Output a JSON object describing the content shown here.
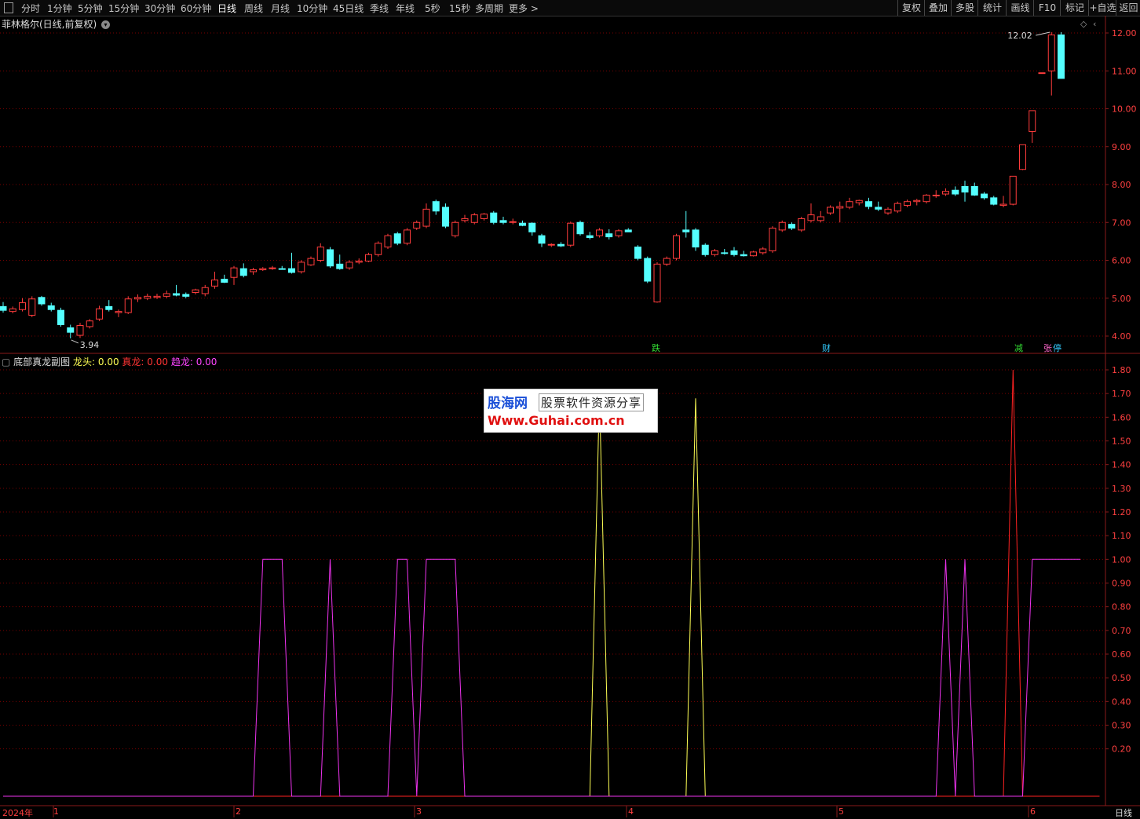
{
  "toolbar": {
    "periods": [
      "分时",
      "1分钟",
      "5分钟",
      "15分钟",
      "30分钟",
      "60分钟",
      "日线",
      "周线",
      "月线",
      "10分钟",
      "45日线",
      "季线",
      "年线",
      "5秒",
      "15秒",
      "多周期",
      "更多 >"
    ],
    "active_period": "日线",
    "right_buttons": [
      "复权",
      "叠加",
      "多股",
      "统计",
      "画线",
      "F10",
      "标记",
      "+自选",
      "返回"
    ]
  },
  "stock": {
    "title": "菲林格尔(日线,前复权)",
    "dropdown_icon": "chevron-down-icon"
  },
  "main_chart": {
    "y_ticks": [
      "12.00",
      "11.00",
      "10.00",
      "9.00",
      "8.00",
      "7.00",
      "6.00",
      "5.00",
      "4.00"
    ],
    "high_label": "12.02",
    "low_label": "3.94",
    "signals": [
      {
        "text": "跌",
        "color": "#33dd33"
      },
      {
        "text": "财",
        "color": "#33ccff"
      },
      {
        "text": "减",
        "color": "#33dd33"
      },
      {
        "text": "张",
        "color": "#ff66cc"
      },
      {
        "text": "停",
        "color": "#33ccff"
      }
    ]
  },
  "indicator": {
    "name": "底部真龙副图",
    "items": [
      {
        "label": "龙头:",
        "value": "0.00",
        "color": "#ffff55"
      },
      {
        "label": "真龙:",
        "value": "0.00",
        "color": "#ff3333"
      },
      {
        "label": "趋龙:",
        "value": "0.00",
        "color": "#ff44ff"
      }
    ],
    "y_ticks": [
      "1.80",
      "1.70",
      "1.60",
      "1.50",
      "1.40",
      "1.30",
      "1.20",
      "1.10",
      "1.00",
      "0.90",
      "0.80",
      "0.70",
      "0.60",
      "0.50",
      "0.40",
      "0.30",
      "0.20"
    ]
  },
  "watermark": {
    "logo": "股海网",
    "tagline": "股票软件资源分享",
    "url": "Www.Guhai.com.cn"
  },
  "bottom_axis": {
    "year_label": "2024年",
    "months": [
      "1",
      "2",
      "3",
      "4",
      "5",
      "6"
    ],
    "period_label": "日线"
  },
  "colors": {
    "up": "#ff3c3c",
    "down": "#54ffff",
    "grid": "#7a0000",
    "axis_text": "#ff4040",
    "line_longtou": "#ffff55",
    "line_zhenlong": "#ff2222",
    "line_qulong": "#ee33ee"
  },
  "chart_data": [
    {
      "type": "candlestick",
      "title": "菲林格尔(日线,前复权)",
      "y_range": [
        3.8,
        12.1
      ],
      "annotations": [
        {
          "text": "12.02",
          "kind": "high"
        },
        {
          "text": "3.94",
          "kind": "low"
        }
      ],
      "candles": [
        [
          4.78,
          4.9,
          4.62,
          4.68
        ],
        [
          4.65,
          4.78,
          4.6,
          4.72
        ],
        [
          4.7,
          5.0,
          4.65,
          4.88
        ],
        [
          4.55,
          5.05,
          4.5,
          4.98
        ],
        [
          5.02,
          5.06,
          4.8,
          4.85
        ],
        [
          4.8,
          4.88,
          4.65,
          4.7
        ],
        [
          4.68,
          4.75,
          4.25,
          4.3
        ],
        [
          4.22,
          4.3,
          3.94,
          4.1
        ],
        [
          4.02,
          4.35,
          3.95,
          4.28
        ],
        [
          4.25,
          4.45,
          4.2,
          4.4
        ],
        [
          4.45,
          4.8,
          4.4,
          4.72
        ],
        [
          4.78,
          4.95,
          4.65,
          4.7
        ],
        [
          4.62,
          4.7,
          4.5,
          4.65
        ],
        [
          4.62,
          5.05,
          4.58,
          4.98
        ],
        [
          4.98,
          5.1,
          4.9,
          5.02
        ],
        [
          5.0,
          5.12,
          4.95,
          5.05
        ],
        [
          5.02,
          5.12,
          4.98,
          5.05
        ],
        [
          5.05,
          5.2,
          5.0,
          5.12
        ],
        [
          5.12,
          5.35,
          5.05,
          5.08
        ],
        [
          5.1,
          5.15,
          5.0,
          5.05
        ],
        [
          5.15,
          5.25,
          5.1,
          5.22
        ],
        [
          5.12,
          5.35,
          5.05,
          5.28
        ],
        [
          5.32,
          5.7,
          5.25,
          5.48
        ],
        [
          5.5,
          5.62,
          5.4,
          5.42
        ],
        [
          5.55,
          5.85,
          5.35,
          5.8
        ],
        [
          5.78,
          5.92,
          5.55,
          5.6
        ],
        [
          5.7,
          5.8,
          5.62,
          5.75
        ],
        [
          5.75,
          5.82,
          5.72,
          5.78
        ],
        [
          5.78,
          5.85,
          5.75,
          5.8
        ],
        [
          5.78,
          5.85,
          5.75,
          5.76
        ],
        [
          5.78,
          6.2,
          5.65,
          5.68
        ],
        [
          5.7,
          6.0,
          5.65,
          5.95
        ],
        [
          5.88,
          6.1,
          5.85,
          6.05
        ],
        [
          6.0,
          6.45,
          5.95,
          6.35
        ],
        [
          6.28,
          6.35,
          5.8,
          5.85
        ],
        [
          5.9,
          6.15,
          5.75,
          5.78
        ],
        [
          5.8,
          6.0,
          5.75,
          5.95
        ],
        [
          5.95,
          6.05,
          5.9,
          5.98
        ],
        [
          5.98,
          6.2,
          5.95,
          6.15
        ],
        [
          6.15,
          6.5,
          6.1,
          6.45
        ],
        [
          6.35,
          6.7,
          6.3,
          6.65
        ],
        [
          6.7,
          6.75,
          6.4,
          6.45
        ],
        [
          6.45,
          6.85,
          6.4,
          6.8
        ],
        [
          6.85,
          7.05,
          6.8,
          7.0
        ],
        [
          6.9,
          7.5,
          6.85,
          7.35
        ],
        [
          7.55,
          7.6,
          7.2,
          7.3
        ],
        [
          7.4,
          7.5,
          6.85,
          6.9
        ],
        [
          6.65,
          7.05,
          6.6,
          7.0
        ],
        [
          7.05,
          7.2,
          7.0,
          7.1
        ],
        [
          7.0,
          7.25,
          6.95,
          7.2
        ],
        [
          7.1,
          7.25,
          7.05,
          7.22
        ],
        [
          7.25,
          7.3,
          6.95,
          7.0
        ],
        [
          7.05,
          7.15,
          6.95,
          7.0
        ],
        [
          7.0,
          7.1,
          6.95,
          7.02
        ],
        [
          6.98,
          7.05,
          6.9,
          6.92
        ],
        [
          6.98,
          7.0,
          6.65,
          6.75
        ],
        [
          6.65,
          6.7,
          6.35,
          6.45
        ],
        [
          6.4,
          6.45,
          6.35,
          6.42
        ],
        [
          6.42,
          6.48,
          6.35,
          6.38
        ],
        [
          6.4,
          7.02,
          6.35,
          6.98
        ],
        [
          7.0,
          7.05,
          6.65,
          6.7
        ],
        [
          6.65,
          6.75,
          6.55,
          6.6
        ],
        [
          6.65,
          6.85,
          6.6,
          6.8
        ],
        [
          6.7,
          6.82,
          6.55,
          6.62
        ],
        [
          6.65,
          6.82,
          6.6,
          6.78
        ],
        [
          6.8,
          6.85,
          6.75,
          6.75
        ],
        [
          6.35,
          6.4,
          6.0,
          6.05
        ],
        [
          6.05,
          6.1,
          5.4,
          5.45
        ],
        [
          4.9,
          5.95,
          4.88,
          5.9
        ],
        [
          5.9,
          6.1,
          5.85,
          6.05
        ],
        [
          6.05,
          6.7,
          6.0,
          6.65
        ],
        [
          6.8,
          7.3,
          6.6,
          6.75
        ],
        [
          6.8,
          6.85,
          6.25,
          6.35
        ],
        [
          6.4,
          6.45,
          6.1,
          6.15
        ],
        [
          6.15,
          6.3,
          6.1,
          6.25
        ],
        [
          6.2,
          6.3,
          6.15,
          6.18
        ],
        [
          6.25,
          6.35,
          6.1,
          6.15
        ],
        [
          6.15,
          6.25,
          6.1,
          6.12
        ],
        [
          6.12,
          6.25,
          6.1,
          6.22
        ],
        [
          6.2,
          6.35,
          6.15,
          6.3
        ],
        [
          6.25,
          6.9,
          6.2,
          6.85
        ],
        [
          6.8,
          7.05,
          6.75,
          7.0
        ],
        [
          6.95,
          7.0,
          6.8,
          6.85
        ],
        [
          6.8,
          7.15,
          6.75,
          7.1
        ],
        [
          7.05,
          7.5,
          7.0,
          7.2
        ],
        [
          7.05,
          7.3,
          7.0,
          7.15
        ],
        [
          7.25,
          7.45,
          7.2,
          7.4
        ],
        [
          7.38,
          7.55,
          7.0,
          7.42
        ],
        [
          7.4,
          7.65,
          7.35,
          7.55
        ],
        [
          7.52,
          7.6,
          7.45,
          7.58
        ],
        [
          7.55,
          7.65,
          7.35,
          7.42
        ],
        [
          7.4,
          7.55,
          7.3,
          7.35
        ],
        [
          7.25,
          7.4,
          7.2,
          7.35
        ],
        [
          7.3,
          7.55,
          7.25,
          7.5
        ],
        [
          7.45,
          7.6,
          7.4,
          7.55
        ],
        [
          7.55,
          7.62,
          7.45,
          7.58
        ],
        [
          7.55,
          7.75,
          7.5,
          7.72
        ],
        [
          7.72,
          7.85,
          7.65,
          7.72
        ],
        [
          7.75,
          7.9,
          7.7,
          7.82
        ],
        [
          7.85,
          7.95,
          7.7,
          7.75
        ],
        [
          7.95,
          8.1,
          7.55,
          7.8
        ],
        [
          7.95,
          8.05,
          7.7,
          7.72
        ],
        [
          7.75,
          7.8,
          7.6,
          7.65
        ],
        [
          7.65,
          7.7,
          7.45,
          7.48
        ],
        [
          7.45,
          7.7,
          7.4,
          7.48
        ],
        [
          7.48,
          8.22,
          7.45,
          8.22
        ],
        [
          8.4,
          9.05,
          8.38,
          9.05
        ],
        [
          9.4,
          9.95,
          9.1,
          9.95
        ],
        [
          10.95,
          10.95,
          10.95,
          10.95
        ],
        [
          11.0,
          12.02,
          10.35,
          11.95
        ],
        [
          11.95,
          12.02,
          10.8,
          10.8
        ]
      ]
    },
    {
      "type": "line",
      "title": "底部真龙副图",
      "y_range": [
        0,
        1.8
      ],
      "series": [
        {
          "name": "龙头",
          "color": "#ffff55",
          "values": [
            [
              0,
              0
            ],
            [
              61,
              0
            ],
            [
              62,
              1.7
            ],
            [
              63,
              0
            ],
            [
              71,
              0
            ],
            [
              72,
              1.68
            ],
            [
              73,
              0
            ],
            [
              114,
              0
            ]
          ]
        },
        {
          "name": "真龙",
          "color": "#ff2222",
          "values": [
            [
              0,
              0
            ],
            [
              104,
              0
            ],
            [
              105,
              1.8
            ],
            [
              106,
              0
            ],
            [
              114,
              0
            ]
          ]
        },
        {
          "name": "趋龙",
          "color": "#ee33ee",
          "values": [
            [
              0,
              0
            ],
            [
              26,
              0
            ],
            [
              27,
              1
            ],
            [
              29,
              1
            ],
            [
              30,
              0
            ],
            [
              33,
              0
            ],
            [
              34,
              1
            ],
            [
              35,
              0
            ],
            [
              40,
              0
            ],
            [
              41,
              1
            ],
            [
              42,
              1
            ],
            [
              43,
              0
            ],
            [
              44,
              1
            ],
            [
              47,
              1
            ],
            [
              48,
              0
            ],
            [
              97,
              0
            ],
            [
              98,
              1
            ],
            [
              99,
              0
            ],
            [
              100,
              1
            ],
            [
              101,
              0
            ],
            [
              106,
              0
            ],
            [
              107,
              1
            ],
            [
              112,
              1
            ]
          ]
        }
      ]
    }
  ]
}
